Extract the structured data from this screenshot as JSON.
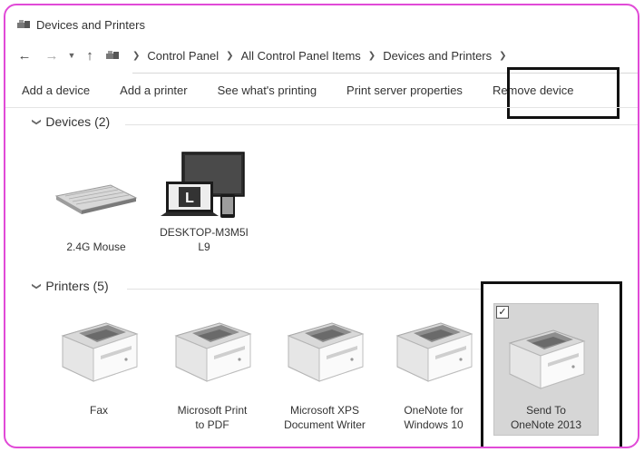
{
  "window": {
    "title": "Devices and Printers"
  },
  "address_bar": {
    "breadcrumbs": [
      "Control Panel",
      "All Control Panel Items",
      "Devices and Printers"
    ]
  },
  "toolbar": {
    "add_device": "Add a device",
    "add_printer": "Add a printer",
    "see_printing": "See what's printing",
    "print_server": "Print server properties",
    "remove_device": "Remove device"
  },
  "devices_group": {
    "header": "Devices (2)",
    "items": [
      {
        "label": "2.4G Mouse",
        "icon": "keyboard-icon"
      },
      {
        "label": "DESKTOP-M3M5I\nL9",
        "icon": "computer-icon"
      }
    ]
  },
  "printers_group": {
    "header": "Printers (5)",
    "items": [
      {
        "label": "Fax",
        "icon": "printer-icon"
      },
      {
        "label": "Microsoft Print\nto PDF",
        "icon": "printer-icon"
      },
      {
        "label": "Microsoft XPS\nDocument Writer",
        "icon": "printer-icon"
      },
      {
        "label": "OneNote for\nWindows 10",
        "icon": "printer-icon"
      },
      {
        "label": "Send To\nOneNote 2013",
        "icon": "printer-icon",
        "selected": true
      }
    ]
  }
}
